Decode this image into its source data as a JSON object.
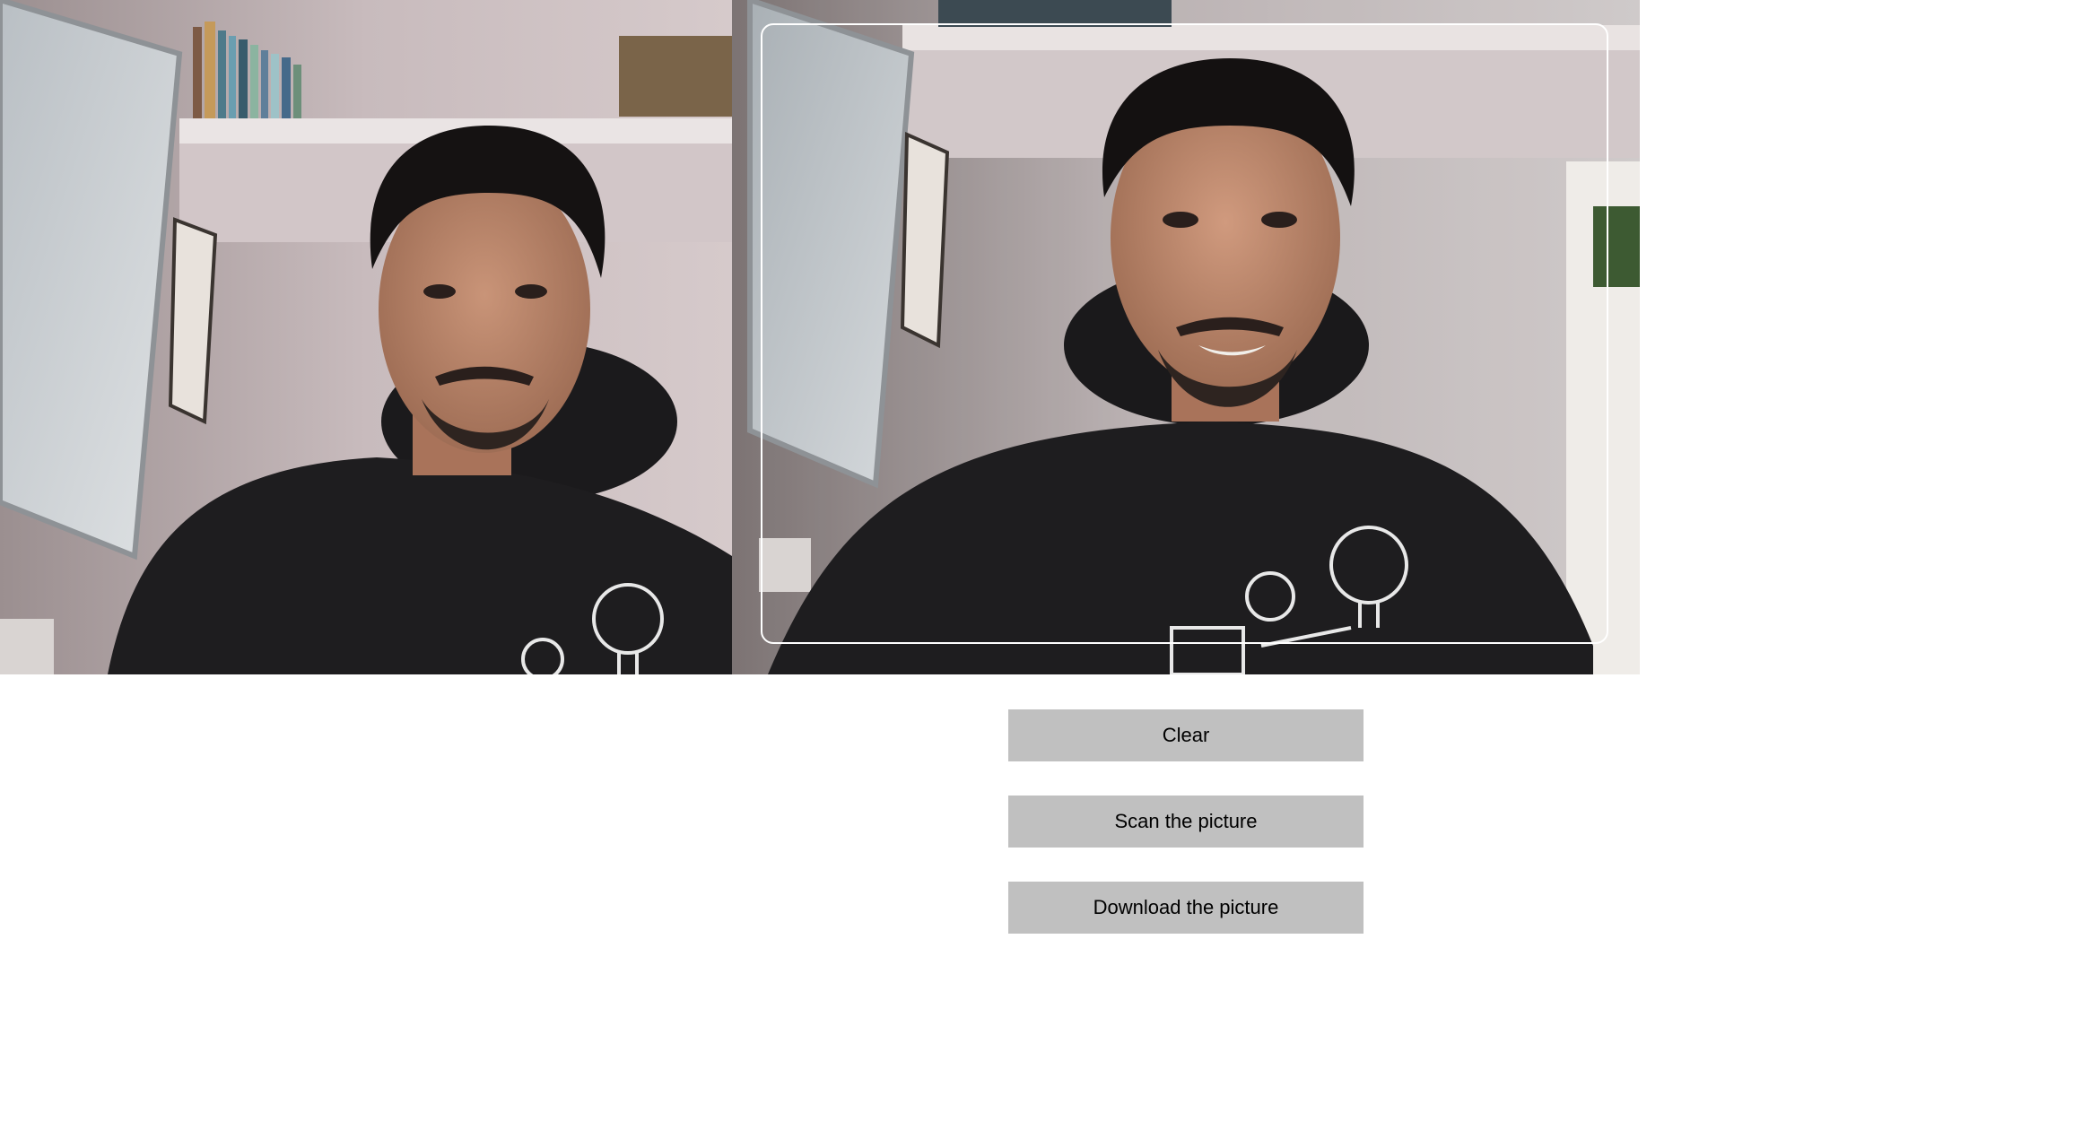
{
  "capture_preview": {
    "description_icon": "person-portrait"
  },
  "buttons": {
    "clear": "Clear",
    "scan": "Scan the picture",
    "download": "Download the picture"
  },
  "colors": {
    "button_bg": "#c0c0c0",
    "frame_border": "#ffffff",
    "page_bg": "#ffffff"
  }
}
